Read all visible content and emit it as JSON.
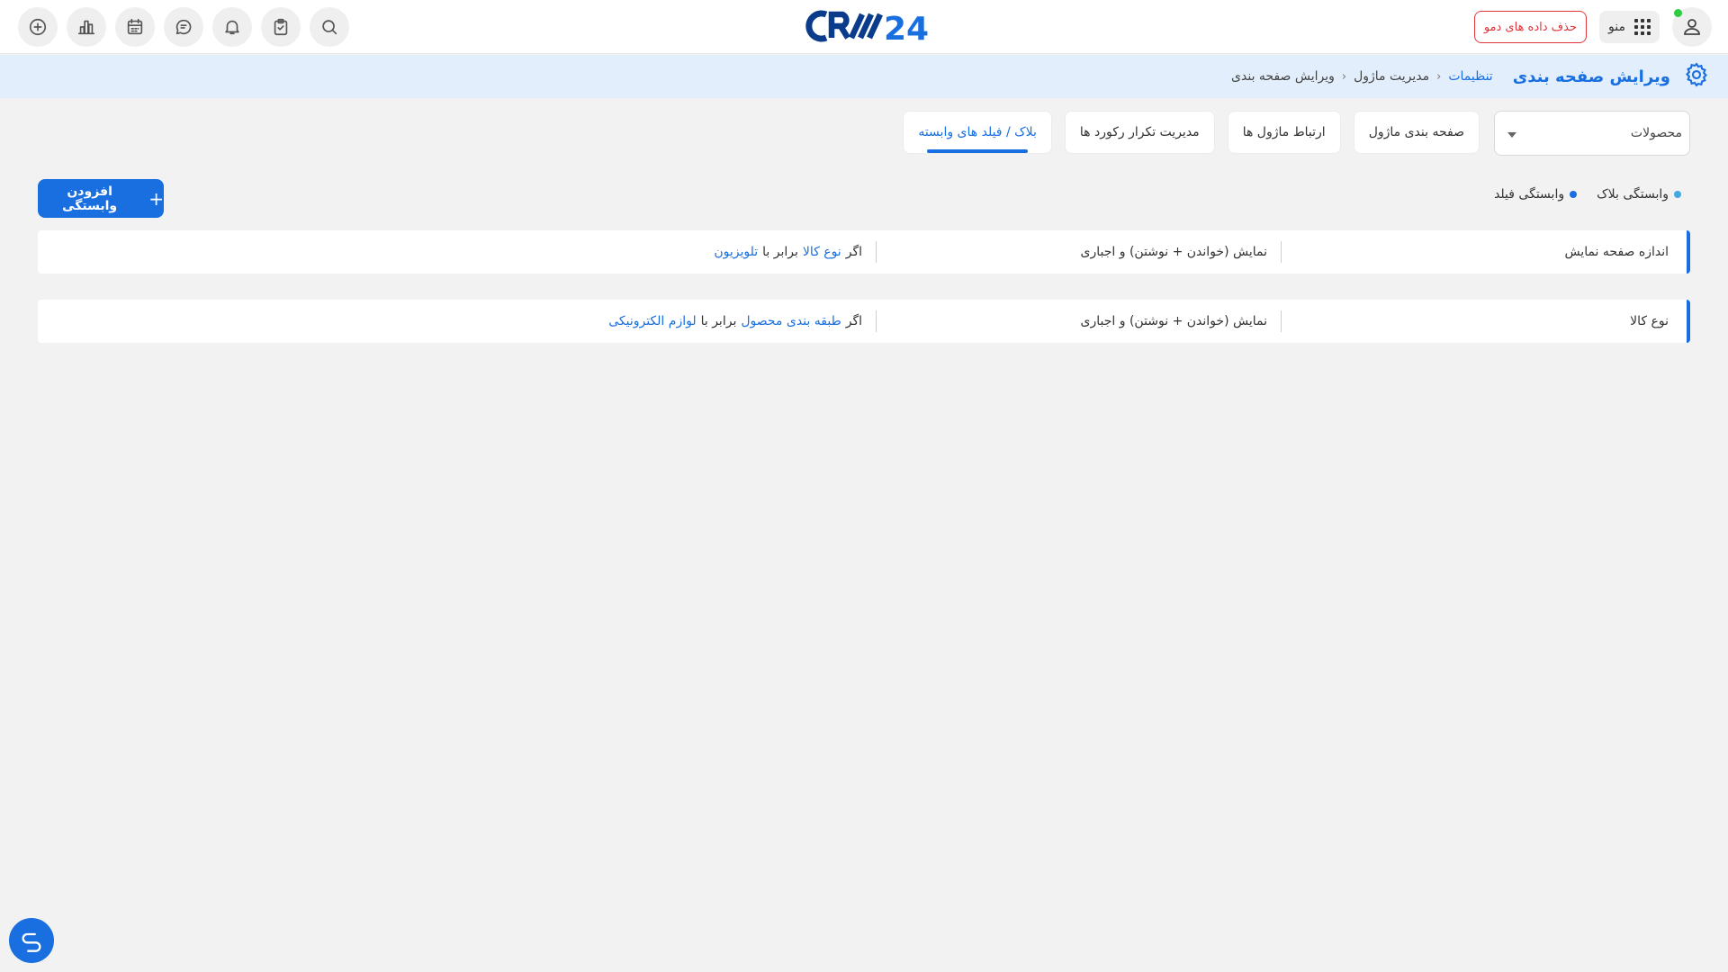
{
  "header": {
    "logo_text": "CRM24",
    "demo_button_label": "حذف داده های دمو",
    "menu_label": "منو",
    "toolbar_icons": [
      "add-circle-icon",
      "bar-chart-icon",
      "calendar-icon",
      "chat-icon",
      "bell-icon",
      "clipboard-icon",
      "search-icon"
    ]
  },
  "breadcrumb": {
    "page_title": "ویرایش صفحه بندی",
    "items": [
      "تنظیمات",
      "مدیریت ماژول",
      "ویرایش صفحه بندی"
    ]
  },
  "module_select": {
    "selected": "محصولات"
  },
  "tabs": [
    {
      "label": "صفحه بندی ماژول",
      "active": false
    },
    {
      "label": "ارتباط ماژول ها",
      "active": false
    },
    {
      "label": "مدیریت تکرار رکورد ها",
      "active": false
    },
    {
      "label": "بلاک / فیلد های وابسته",
      "active": true
    }
  ],
  "legend": {
    "block_label": "وابستگی بلاک",
    "block_color": "#3fa9e0",
    "field_label": "وابستگی فیلد",
    "field_color": "#1a6fe0"
  },
  "add_button_label": "افزودن وابستگی",
  "dependencies": [
    {
      "field": "اندازه صفحه نمایش",
      "mode": "نمایش (خواندن + نوشتن) و اجباری",
      "cond_if": "اگر",
      "cond_field": "نوع کالا",
      "cond_op": "برابر با",
      "cond_value": "تلویزیون"
    },
    {
      "field": "نوع کالا",
      "mode": "نمایش (خواندن + نوشتن) و اجباری",
      "cond_if": "اگر",
      "cond_field": "طبقه بندی محصول",
      "cond_op": "برابر با",
      "cond_value": "لوازم الکترونیکی"
    }
  ],
  "colors": {
    "accent": "#1a6fe0",
    "danger": "#e0353b",
    "breadcrumb_bg": "#e3eefc"
  }
}
